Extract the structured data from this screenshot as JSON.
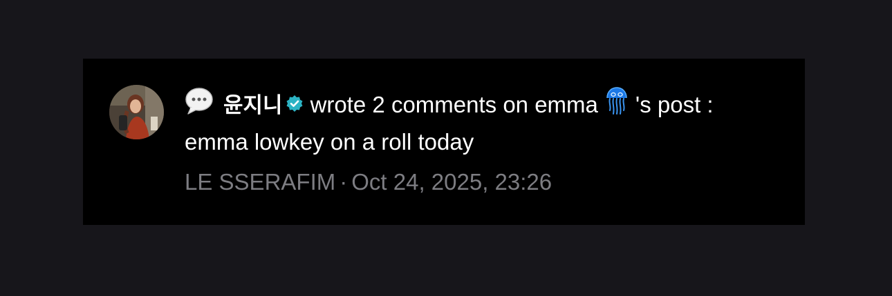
{
  "notification": {
    "author_name": "윤지니",
    "action_text": "wrote 2 comments on emma",
    "post_suffix": "'s post :",
    "comment_text": "emma lowkey on a roll today",
    "group_name": "LE SSERAFIM",
    "separator": "·",
    "timestamp": "Oct 24, 2025, 23:26"
  },
  "icons": {
    "leading": "speech-bubble-icon",
    "verified": "verified-badge-icon",
    "target_emoji": "jellyfish-icon"
  },
  "colors": {
    "background": "#17161b",
    "card": "#000000",
    "text": "#ffffff",
    "muted": "#7d7d82",
    "verified": "#2cb3c4"
  }
}
